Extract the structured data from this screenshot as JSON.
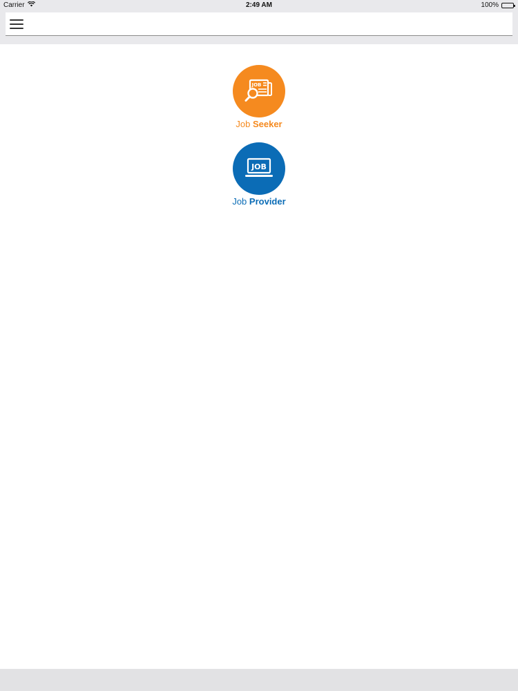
{
  "status_bar": {
    "carrier": "Carrier",
    "time": "2:49 AM",
    "battery_percent": "100%",
    "battery_level": 1.0
  },
  "nav": {
    "menu_icon": "hamburger-menu-icon"
  },
  "roles": {
    "seeker": {
      "label_prefix": "Job",
      "label_strong": "Seeker",
      "icon": "job-search-icon",
      "icon_text": "JOB",
      "color": "#f58a1f"
    },
    "provider": {
      "label_prefix": "Job",
      "label_strong": "Provider",
      "icon": "job-laptop-icon",
      "icon_text": "JOB",
      "color": "#0b6cb6"
    }
  }
}
